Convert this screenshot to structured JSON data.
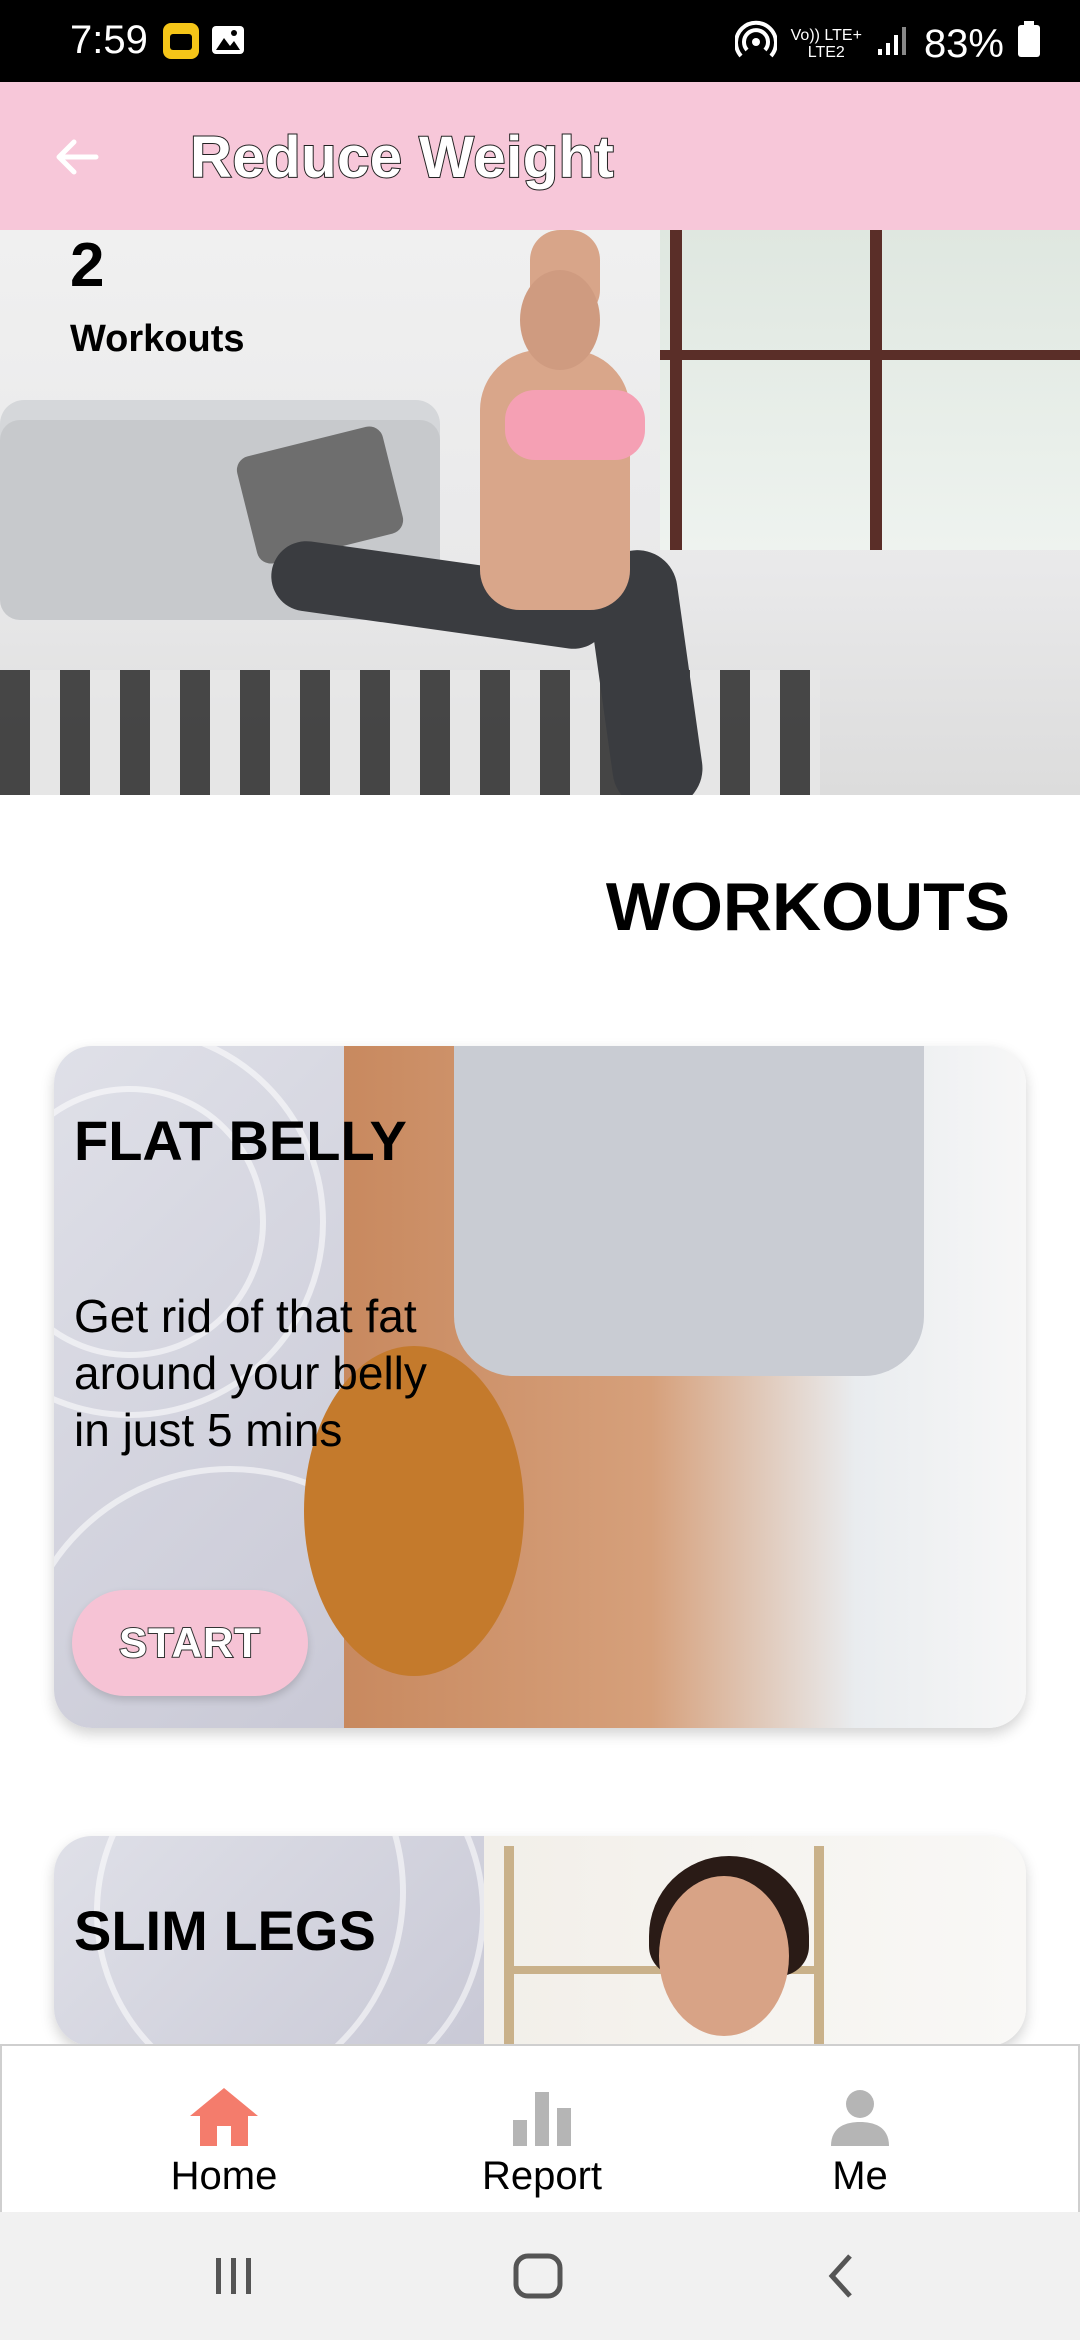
{
  "status_bar": {
    "time": "7:59",
    "network_top": "Vo)) LTE+",
    "network_bottom": "LTE2",
    "battery": "83%"
  },
  "app_bar": {
    "title": "Reduce Weight",
    "back_icon": "arrow-left-icon"
  },
  "hero": {
    "count": "2",
    "label": "Workouts"
  },
  "section": {
    "title": "WORKOUTS"
  },
  "workouts": [
    {
      "title": "FLAT BELLY",
      "description": "Get rid of that fat around your belly in just 5 mins",
      "button": "START"
    },
    {
      "title": "SLIM LEGS"
    }
  ],
  "bottom_nav": {
    "items": [
      {
        "label": "Home",
        "icon": "home-icon",
        "active": true
      },
      {
        "label": "Report",
        "icon": "bar-chart-icon",
        "active": false
      },
      {
        "label": "Me",
        "icon": "person-icon",
        "active": false
      }
    ]
  },
  "colors": {
    "accent_pink": "#f7c7d9",
    "home_active": "#f47c6c",
    "inactive_icon": "#b5b5b5"
  }
}
